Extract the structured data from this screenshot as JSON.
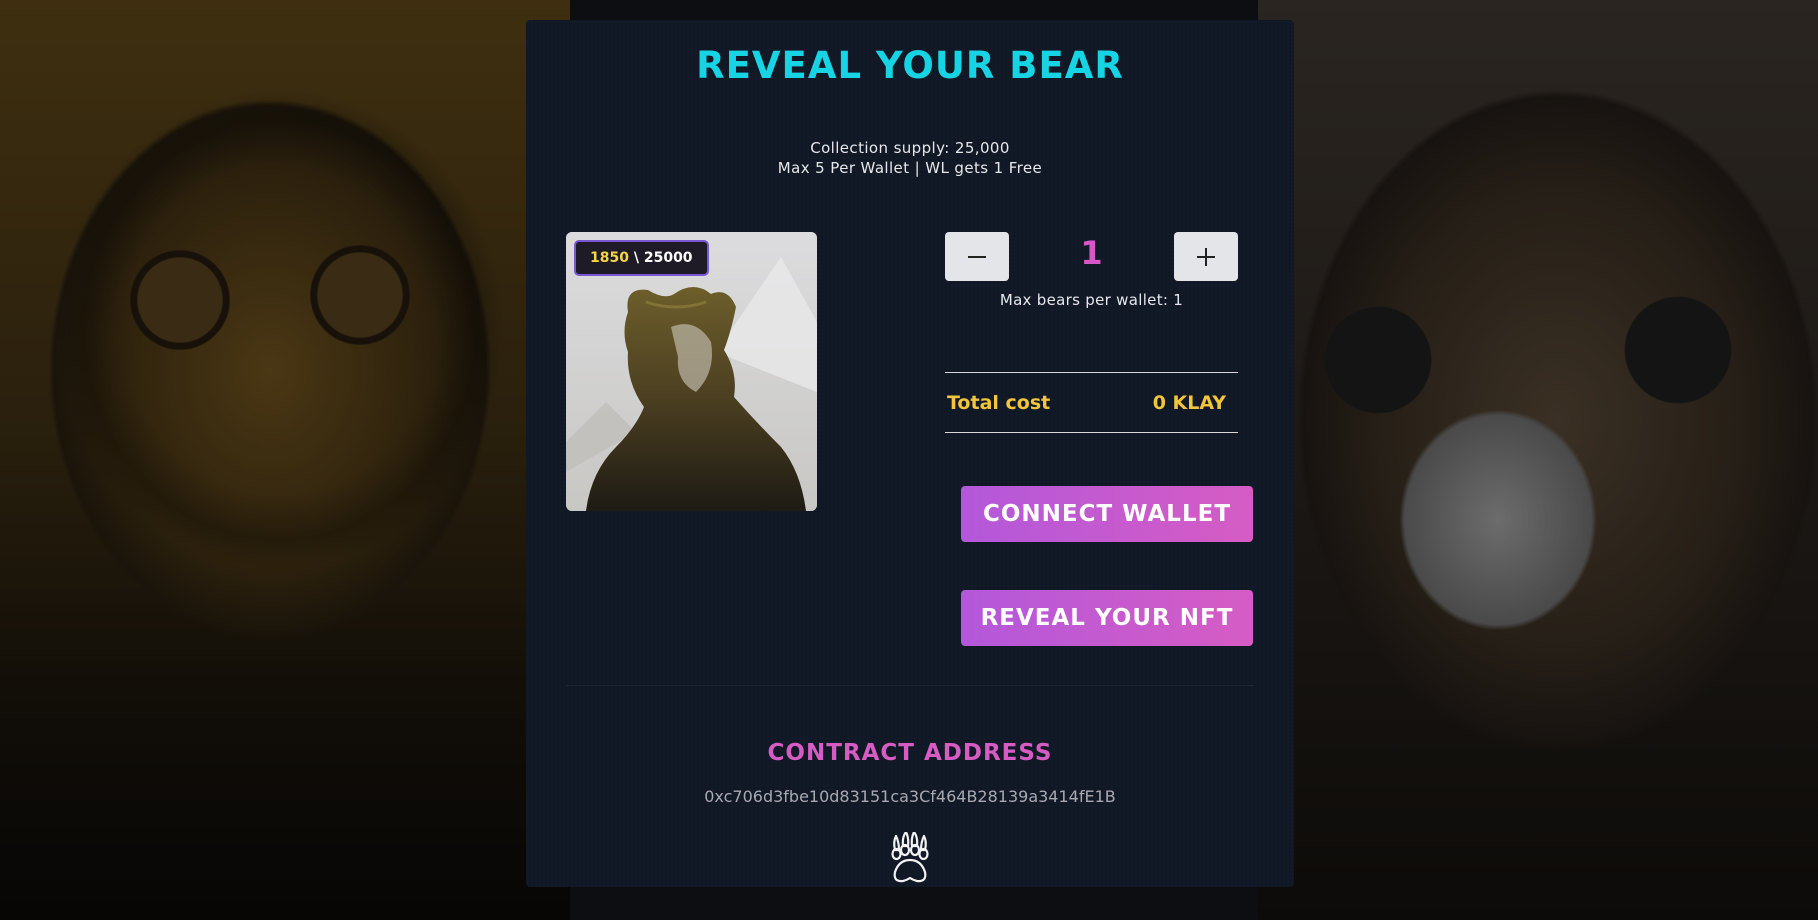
{
  "page": {
    "title": "REVEAL YOUR BEAR",
    "supply_line": "Collection supply: 25,000",
    "limit_line": "Max 5 Per Wallet | WL gets 1 Free"
  },
  "preview": {
    "image_name": "bear-silhouette-mountain-artwork",
    "minted": "1850",
    "separator": " \\ ",
    "total": "25000"
  },
  "quantity": {
    "minus_icon": "minus-icon",
    "plus_icon": "plus-icon",
    "value": "1",
    "max_note": "Max bears per wallet: 1"
  },
  "cost": {
    "label": "Total cost",
    "value": "0 KLAY"
  },
  "buttons": {
    "connect": "CONNECT WALLET",
    "reveal": "REVEAL YOUR NFT"
  },
  "contract": {
    "title": "CONTRACT ADDRESS",
    "address": "0xc706d3fbe10d83151ca3Cf464B28139a3414fE1B"
  },
  "footer": {
    "logo_icon": "bear-paw-icon"
  },
  "colors": {
    "accent_cyan": "#17d4e4",
    "accent_pink": "#d65cc4",
    "accent_purple": "#b358da",
    "accent_gold": "#f3c53c",
    "panel_bg": "#101826"
  }
}
